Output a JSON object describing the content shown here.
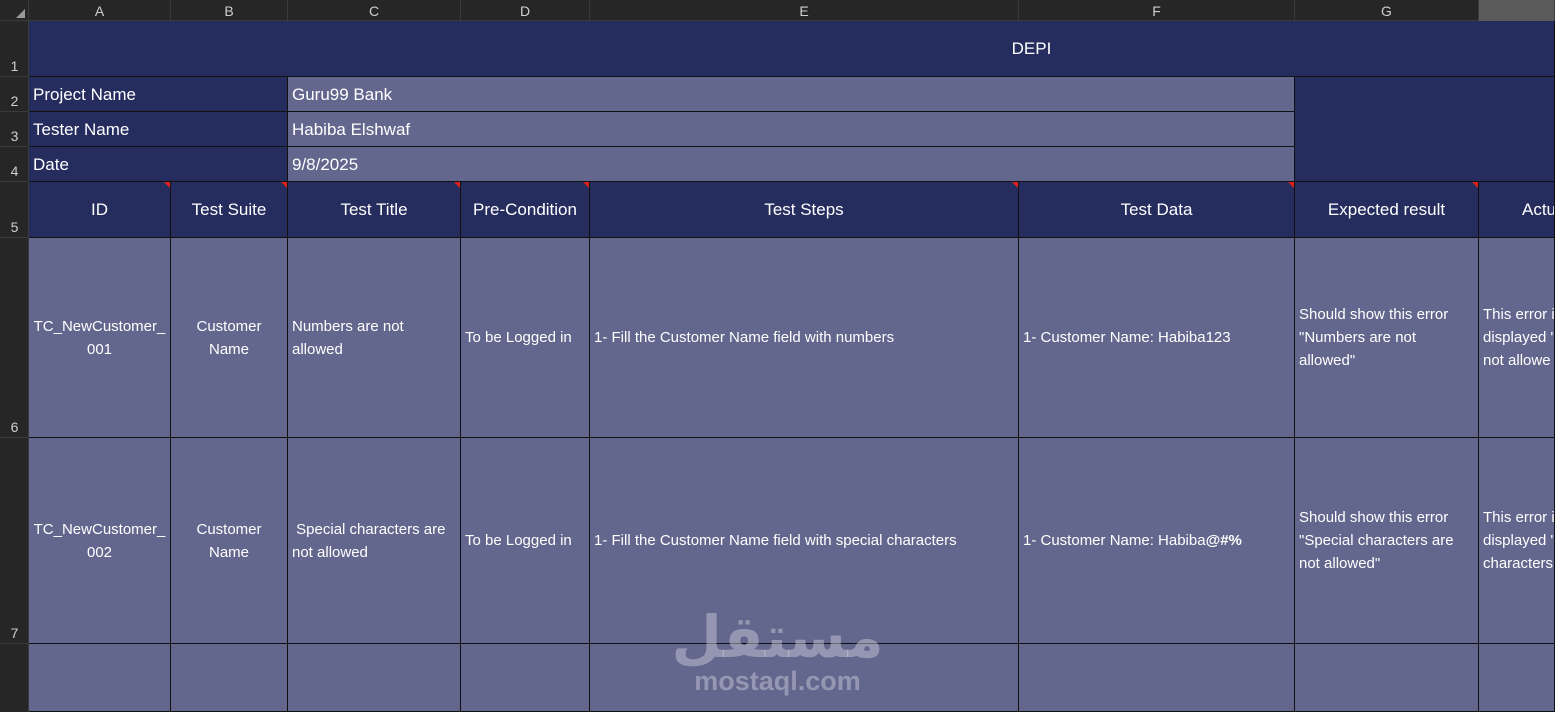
{
  "columns": [
    "A",
    "B",
    "C",
    "D",
    "E",
    "F",
    "G"
  ],
  "rows": [
    "1",
    "2",
    "3",
    "4",
    "5",
    "6",
    "7"
  ],
  "banner": "DEPI",
  "info": {
    "project_label": "Project Name",
    "project_value": "Guru99 Bank",
    "tester_label": "Tester Name",
    "tester_value": "Habiba Elshwaf",
    "date_label": "Date",
    "date_value": "9/8/2025"
  },
  "headers": [
    "ID",
    "Test Suite",
    "Test Title",
    "Pre-Condition",
    "Test Steps",
    "Test Data",
    "Expected result",
    "Actu"
  ],
  "test_cases": [
    {
      "id": "TC_NewCustomer_\n001",
      "suite": "Customer\nName",
      "title": "Numbers are not\nallowed",
      "precondition": "To be Logged in",
      "steps": "1- Fill the Customer Name field with numbers",
      "data": "1- Customer Name: Habiba123",
      "expected": "Should show this error\n\"Numbers are not\nallowed\"",
      "actual": "This error i\ndisplayed \"\nnot allowe"
    },
    {
      "id": "TC_NewCustomer_\n002",
      "suite": "Customer\nName",
      "title": " Special characters are\nnot allowed",
      "precondition": "To be Logged in",
      "steps": "1- Fill the Customer Name field with special characters",
      "data_prefix": "1- Customer Name: Habiba",
      "data_bold": "@#%",
      "expected": "Should show this error\n\"Special characters are\nnot allowed\"",
      "actual": "This error i\ndisplayed \"\ncharacters"
    }
  ],
  "watermark": {
    "arabic": "مستقل",
    "latin": "mostaql.com"
  },
  "colors": {
    "header_fill": "#252c5e",
    "body_fill": "#63668d",
    "note_marker": "#e0201c",
    "chrome": "#262626"
  }
}
